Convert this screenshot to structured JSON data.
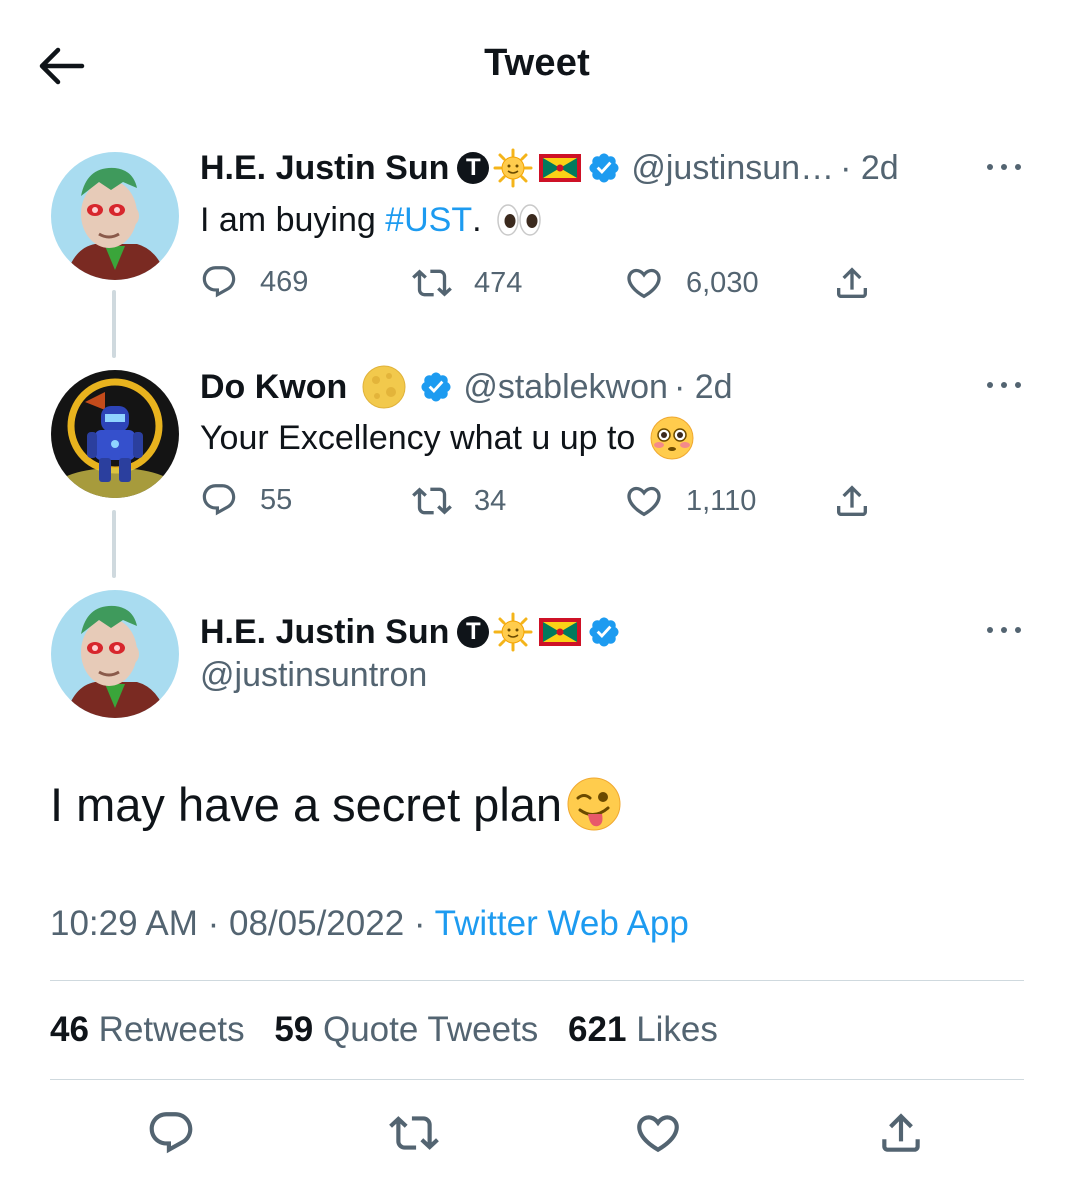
{
  "header": {
    "title": "Tweet"
  },
  "tweets": [
    {
      "display_name": "H.E. Justin Sun",
      "badge_letter": "T",
      "handle": "@justinsun…",
      "time": "· 2d",
      "text_prefix": "I am buying ",
      "hashtag": "#UST",
      "text_suffix": ".",
      "emoji": "eyes",
      "replies": "469",
      "retweets": "474",
      "likes": "6,030"
    },
    {
      "display_name": "Do Kwon",
      "handle": "@stablekwon",
      "time": "· 2d",
      "text": "Your Excellency what u up to",
      "emoji": "flushed-face",
      "replies": "55",
      "retweets": "34",
      "likes": "1,110"
    }
  ],
  "main_tweet": {
    "display_name": "H.E. Justin Sun",
    "badge_letter": "T",
    "handle": "@justinsuntron",
    "text": "I may have a secret plan",
    "emoji": "winking-face-with-tongue",
    "time": "10:29 AM",
    "date": "08/05/2022",
    "separator": " · ",
    "source": "Twitter Web App",
    "retweets_count": "46",
    "retweets_label": "Retweets",
    "quotes_count": "59",
    "quotes_label": "Quote Tweets",
    "likes_count": "621",
    "likes_label": "Likes"
  },
  "colors": {
    "accent": "#1d9bf0",
    "secondary_text": "#536471",
    "divider": "#cfd9de"
  }
}
